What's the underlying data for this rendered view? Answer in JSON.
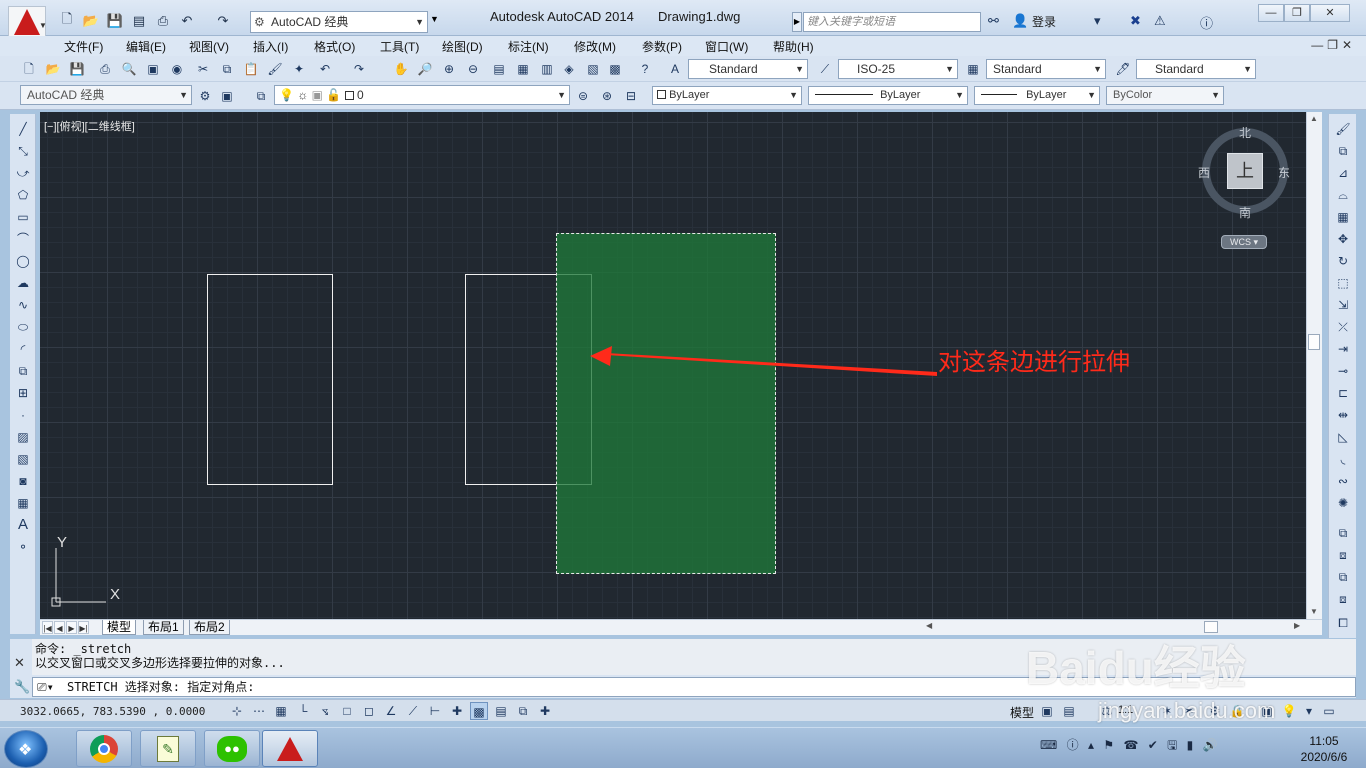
{
  "window": {
    "app_title": "Autodesk AutoCAD 2014",
    "doc_title": "Drawing1.dwg",
    "workspace": "AutoCAD 经典",
    "search_placeholder": "键入关键字或短语",
    "login": "登录"
  },
  "menu": [
    "文件(F)",
    "编辑(E)",
    "视图(V)",
    "插入(I)",
    "格式(O)",
    "工具(T)",
    "绘图(D)",
    "标注(N)",
    "修改(M)",
    "参数(P)",
    "窗口(W)",
    "帮助(H)"
  ],
  "styles": {
    "text_style": "Standard",
    "dim_style": "ISO-25",
    "table_style": "Standard",
    "multileader_style": "Standard"
  },
  "layers": {
    "workspace": "AutoCAD 经典",
    "current_layer": "0",
    "color": "ByLayer",
    "linetype": "ByLayer",
    "lineweight": "ByLayer",
    "plotstyle": "ByColor"
  },
  "viewport": {
    "label": "[−][俯视][二维线框]",
    "annotation": "对这条边进行拉伸",
    "compass_n": "北",
    "compass_s": "南",
    "compass_e": "东",
    "compass_w": "西",
    "cube_face": "上",
    "wcs": "WCS",
    "ucs_x": "X",
    "ucs_y": "Y"
  },
  "tabs": [
    "模型",
    "布局1",
    "布局2"
  ],
  "command": {
    "history_line1": "命令: _stretch",
    "history_line2": "以交叉窗口或交叉多边形选择要拉伸的对象...",
    "prompt": "STRETCH 选择对象: 指定对角点:"
  },
  "status": {
    "coordinates": "3032.0665, 783.5390 , 0.0000",
    "model": "模型",
    "scale": "1:1"
  },
  "taskbar": {
    "time": "11:05",
    "date": "2020/6/6"
  },
  "watermark": {
    "brand": "Baidu经验",
    "url": "jingyan.baidu.com"
  },
  "colors": {
    "canvas_bg": "#212830",
    "selection_fill": "#1f783a",
    "annotation_red": "#ff2a1a"
  }
}
